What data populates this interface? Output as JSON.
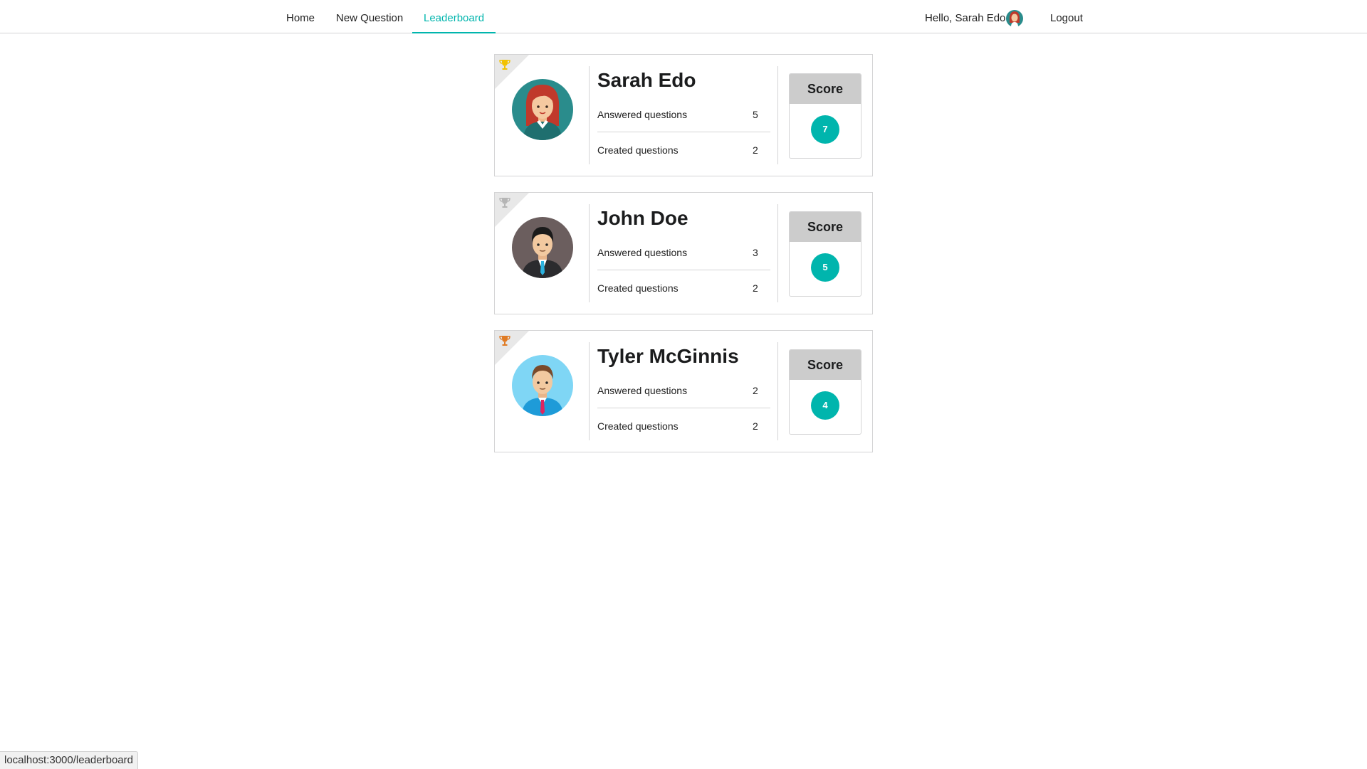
{
  "nav": {
    "home": "Home",
    "new_question": "New Question",
    "leaderboard": "Leaderboard",
    "greeting": "Hello, Sarah Edo",
    "logout": "Logout"
  },
  "colors": {
    "accent": "#00b5ad",
    "gold_trophy": "#f2c200",
    "silver_trophy": "#b5b5b5",
    "bronze_trophy": "#e07b24"
  },
  "leaderboard": [
    {
      "name": "Sarah Edo",
      "answered_label": "Answered questions",
      "answered": "5",
      "created_label": "Created questions",
      "created": "2",
      "score_label": "Score",
      "score": "7",
      "trophy": "gold-trophy-icon"
    },
    {
      "name": "John Doe",
      "answered_label": "Answered questions",
      "answered": "3",
      "created_label": "Created questions",
      "created": "2",
      "score_label": "Score",
      "score": "5",
      "trophy": "silver-trophy-icon"
    },
    {
      "name": "Tyler McGinnis",
      "answered_label": "Answered questions",
      "answered": "2",
      "created_label": "Created questions",
      "created": "2",
      "score_label": "Score",
      "score": "4",
      "trophy": "bronze-trophy-icon"
    }
  ],
  "status_bar": {
    "url": "localhost:3000/leaderboard"
  }
}
